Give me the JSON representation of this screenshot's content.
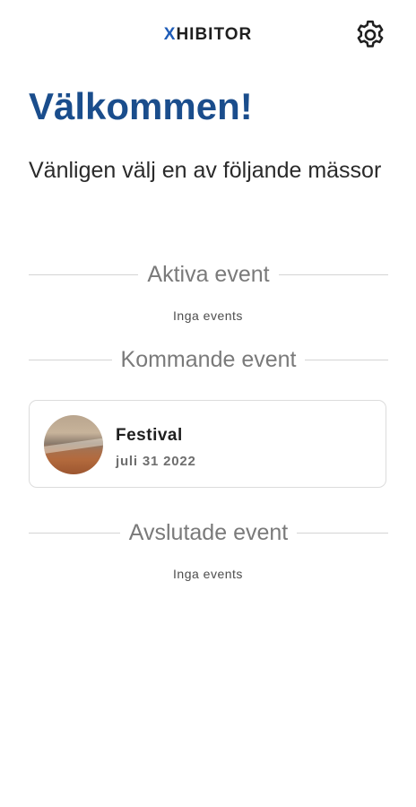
{
  "header": {
    "logo_first": "X",
    "logo_rest": "HIBITOR",
    "settings_icon": "gear-icon"
  },
  "intro": {
    "title": "Välkommen!",
    "subtitle": "Vänligen välj en av följande mässor"
  },
  "sections": {
    "active": {
      "label": "Aktiva event",
      "empty_text": "Inga events"
    },
    "upcoming": {
      "label": "Kommande event",
      "events": [
        {
          "name": "Festival",
          "date": "juli 31 2022"
        }
      ]
    },
    "finished": {
      "label": "Avslutade event",
      "empty_text": "Inga events"
    }
  },
  "colors": {
    "accent": "#1a4d8c",
    "logo_x": "#1e5cb8"
  }
}
